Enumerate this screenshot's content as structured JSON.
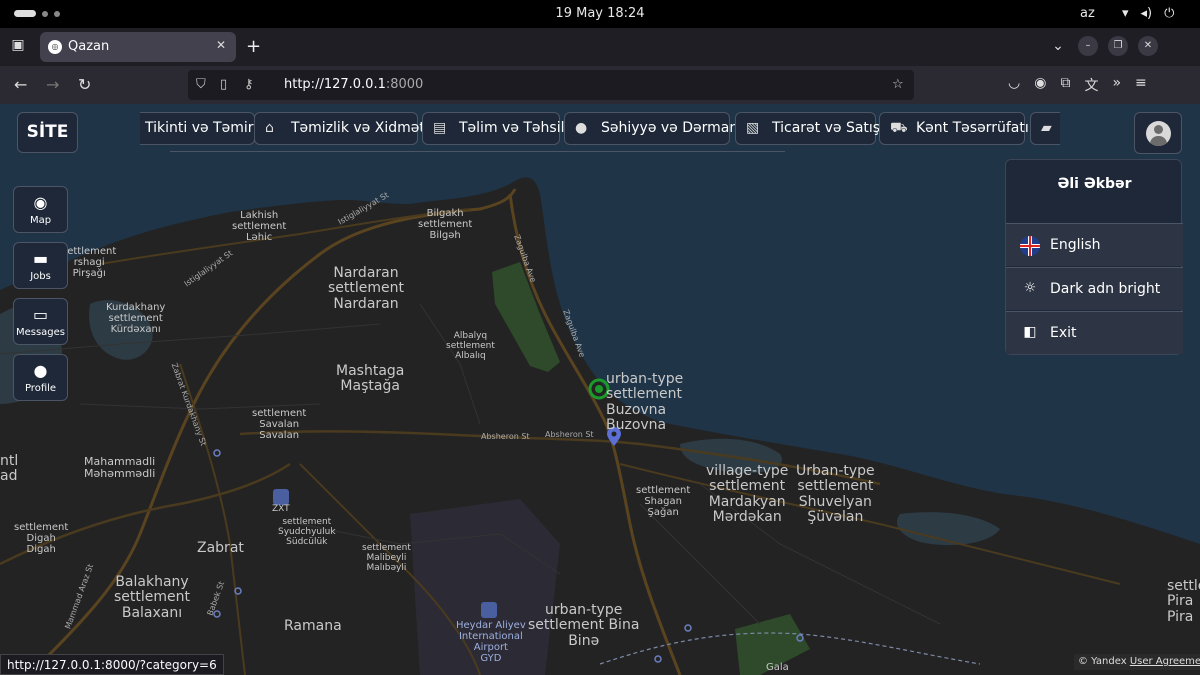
{
  "os": {
    "clock": "19 May  18:24",
    "lang": "az"
  },
  "browser": {
    "tab_title": "Qazan",
    "url_host": "http://127.0.0.1",
    "url_port": ":8000",
    "status_url": "http://127.0.0.1:8000/?category=6"
  },
  "site": {
    "logo": "SİTE",
    "categories": [
      {
        "label": "Tikinti və Təmir",
        "icon": "hammer-icon"
      },
      {
        "label": "Təmizlik və Xidmət",
        "icon": "broom-icon"
      },
      {
        "label": "Təlim və Təhsil",
        "icon": "board-icon"
      },
      {
        "label": "Səhiyyə və Dərman",
        "icon": "doctor-icon"
      },
      {
        "label": "Ticarət və Satış",
        "icon": "receipt-icon"
      },
      {
        "label": "Kənt Təsərrüfatı",
        "icon": "tractor-icon"
      },
      {
        "label": "",
        "icon": "truck-icon"
      }
    ],
    "sidenav": [
      {
        "label": "Map",
        "icon": "map-pin-icon"
      },
      {
        "label": "Jobs",
        "icon": "briefcase-icon"
      },
      {
        "label": "Messages",
        "icon": "chat-icon"
      },
      {
        "label": "Profile",
        "icon": "user-icon"
      }
    ],
    "dropdown": {
      "name": "Əli Əkbər",
      "items": [
        {
          "label": "English",
          "icon": "uk-flag-icon"
        },
        {
          "label": "Dark adn bright",
          "icon": "theme-toggle-icon"
        },
        {
          "label": "Exit",
          "icon": "exit-door-icon"
        }
      ]
    }
  },
  "map": {
    "labels": [
      "Lakhish\nsettlement\nLəhic",
      "Bilgakh\nsettlement\nBilgəh",
      "Nardaran\nsettlement\nNardaran",
      "settlement\nrshagi\nPirşağı",
      "Kurdakhany\nsettlement\nKürdəxanı",
      "Albalyq\nsettlement\nAlbalıq",
      "Mashtaga\nMaştağa",
      "urban-type\nsettlement\nBuzovna\nBuzovna",
      "settlement\nSavalan\nSavalan",
      "Mahammadli\nMəhəmmədli",
      "village-type\nsettlement\nMardakyan\nMərdəkan",
      "Urban-type\nsettlement\nShuvelyan\nŞüvəlan",
      "settlement\nShagan\nŞağan",
      "settlement\nSyudchyuluk\nSüdcülük",
      "settlement\nDigah\nDigah",
      "Zabrat",
      "settlement\nMalibeyli\nMalıbəyli",
      "Balakhany\nsettlement\nBalaxanı",
      "Ramana",
      "Heydar Aliyev\nInternational\nAirport\nGYD",
      "urban-type\nsettlement Bina\nBinə",
      "Gala",
      "ZXT",
      "ntl\nad",
      "settle\nPira\nPira"
    ],
    "roads": [
      "Istiglaliyyat St",
      "Zagulba Ave",
      "Absheron St",
      "Zabrat Kurdakhany St",
      "Istiglaliyyat St",
      "Babek St",
      "Mammad Araz St"
    ],
    "attribution": "© Yandex",
    "agreement": "User Agreement"
  }
}
